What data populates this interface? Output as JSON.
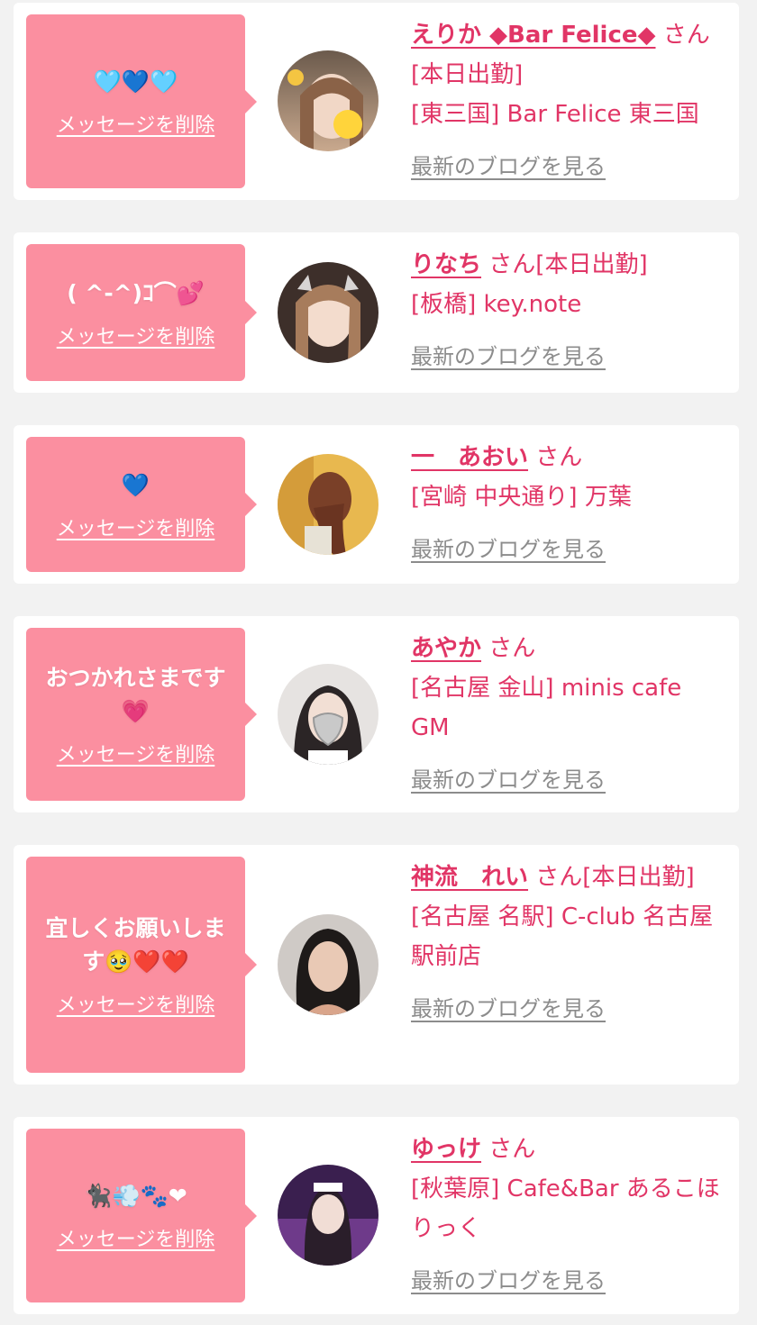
{
  "delete_label": "メッセージを削除",
  "blog_label": "最新のブログを見る",
  "honorific": "さん",
  "colors": {
    "accent": "#e13566",
    "bubble": "#fb8fa0",
    "link_gray": "#8c8c8c",
    "background": "#f2f2f2"
  },
  "items": [
    {
      "message": "🩵💙🩵",
      "name": "えりか ◆Bar Felice◆",
      "status": "[本日出勤]",
      "shop": "[東三国] Bar Felice 東三国"
    },
    {
      "message": "( ^-^)ｺ⌒💕",
      "name": "りなち",
      "status": "[本日出勤]",
      "shop": "[板橋] key.note"
    },
    {
      "message": "💙",
      "name": "一　あおい",
      "status": "",
      "shop": "[宮崎 中央通り] 万葉"
    },
    {
      "message": "おつかれさまです💗",
      "name": "あやか",
      "status": "",
      "shop": "[名古屋 金山] minis cafe GM"
    },
    {
      "message": "宜しくお願いします🥹❤️❤️",
      "name": "神流　れい",
      "status": "[本日出勤]",
      "shop": "[名古屋 名駅] C-club 名古屋駅前店"
    },
    {
      "message": "🐈‍⬛💨🐾❤",
      "name": "ゆっけ",
      "status": "",
      "shop": "[秋葉原] Cafe&Bar あるこほりっく"
    }
  ]
}
